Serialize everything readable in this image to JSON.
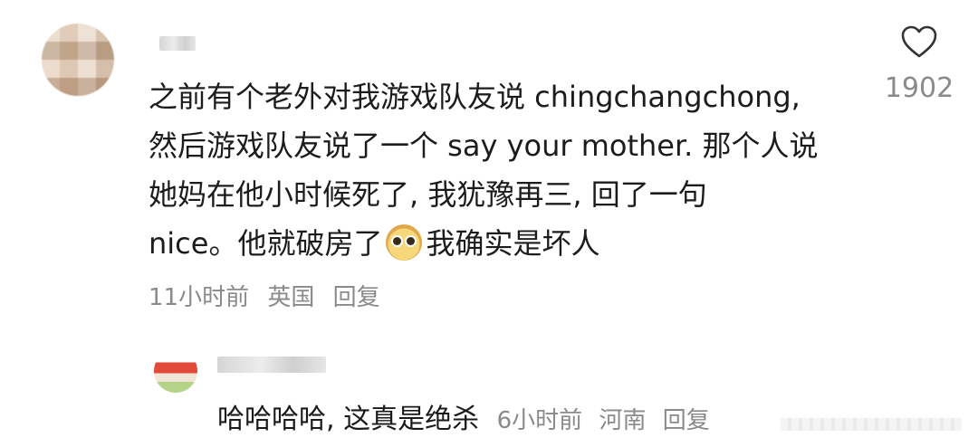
{
  "comment": {
    "lines": [
      "之前有个老外对我游戏队友说 chingchangchong,",
      "然后游戏队友说了一个 say your mother. 那个人说",
      "她妈在他小时候死了, 我犹豫再三, 回了一句",
      "nice。他就破房了"
    ],
    "line4_suffix": "我确实是坏人",
    "time": "11小时前",
    "location": "英国",
    "reply_label": "回复",
    "emoji_icon": "laughing-face-emoji-icon"
  },
  "like": {
    "count": "1902",
    "icon": "heart-icon"
  },
  "reply": {
    "text": "哈哈哈哈, 这真是绝杀",
    "time": "6小时前",
    "location": "河南",
    "reply_label": "回复"
  }
}
